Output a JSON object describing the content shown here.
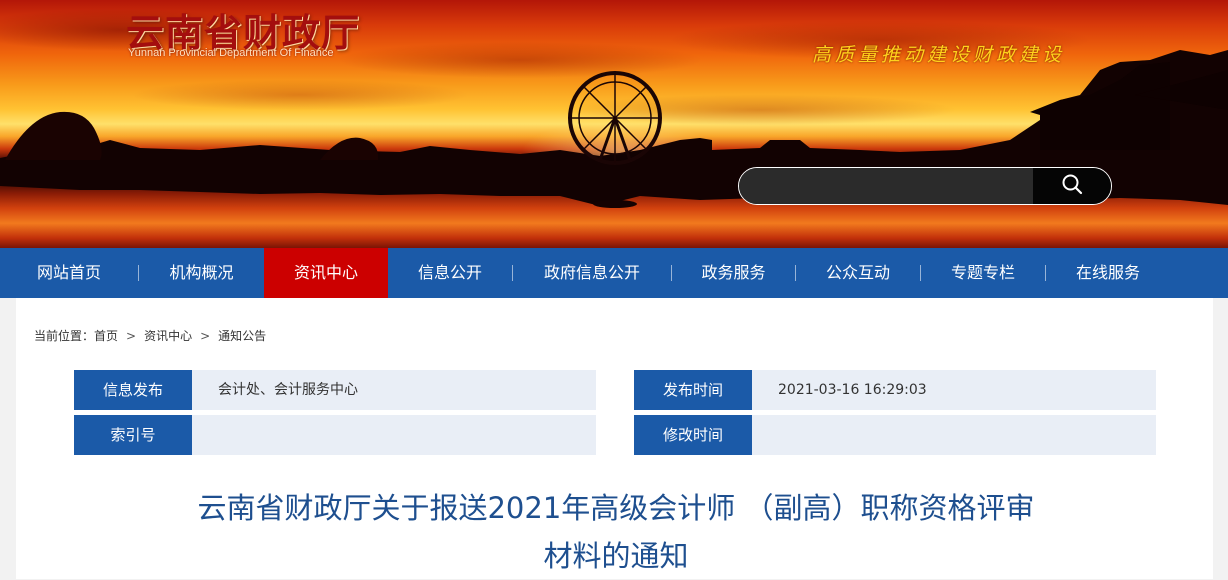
{
  "header": {
    "logo_cn": "云南省财政厅",
    "logo_en": "Yunnan Provincial Department Of Finance",
    "slogan": "高质量推动建设财政建设",
    "search": {
      "value": "",
      "placeholder": "",
      "icon": "search-icon"
    }
  },
  "nav": {
    "active_color": "#cc0000",
    "bar_color": "#1b5aa8",
    "items": [
      {
        "label": "网站首页"
      },
      {
        "label": "机构概况"
      },
      {
        "label": "资讯中心",
        "active": true
      },
      {
        "label": "信息公开"
      },
      {
        "label": "政府信息公开"
      },
      {
        "label": "政务服务"
      },
      {
        "label": "公众互动"
      },
      {
        "label": "专题专栏"
      },
      {
        "label": "在线服务"
      }
    ]
  },
  "breadcrumb": {
    "prefix": "当前位置：",
    "items": [
      "首页",
      "资讯中心",
      "通知公告"
    ],
    "separator": ">"
  },
  "meta": {
    "publisher_label": "信息发布",
    "publisher_value": "会计处、会计服务中心",
    "publish_time_label": "发布时间",
    "publish_time_value": "2021-03-16 16:29:03",
    "index_label": "索引号",
    "index_value": "",
    "modify_time_label": "修改时间",
    "modify_time_value": ""
  },
  "article": {
    "title_line1": "云南省财政厅关于报送2021年高级会计师 （副高）职称资格评审",
    "title_line2": "材料的通知"
  }
}
